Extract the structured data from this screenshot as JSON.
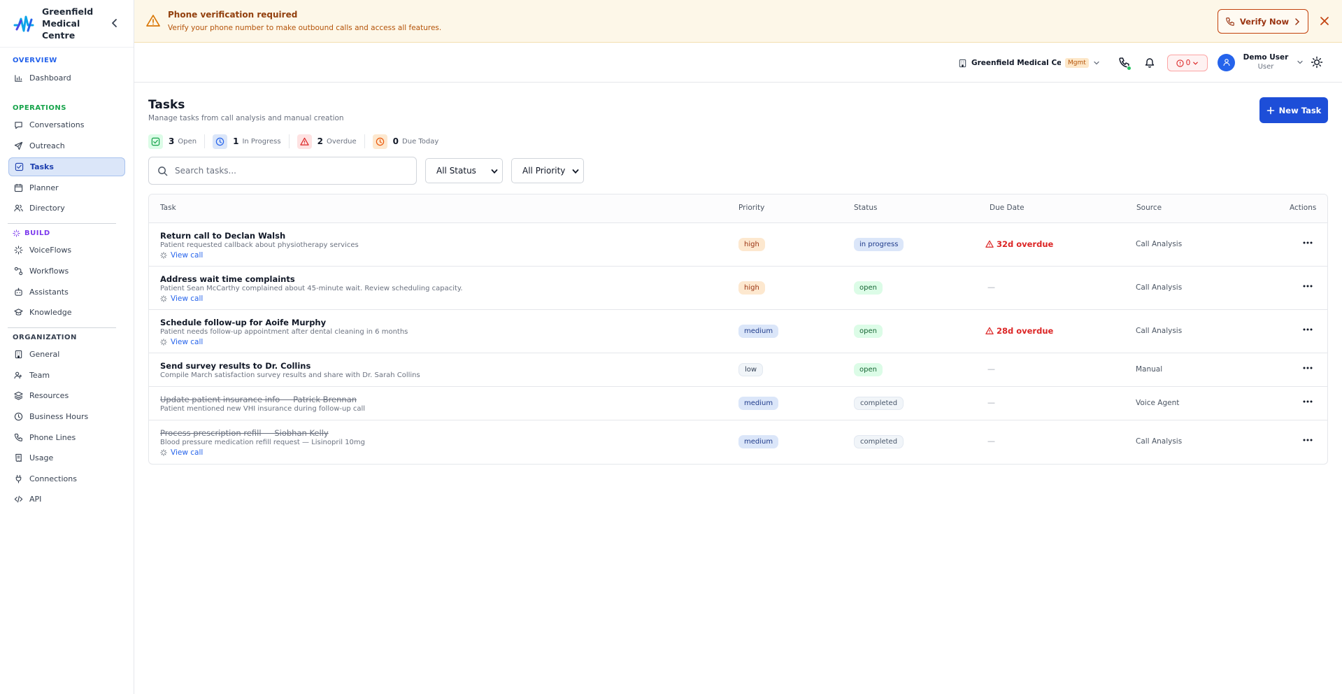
{
  "brand": {
    "name": "Greenfield Medical Centre"
  },
  "sidebar": {
    "sections": [
      {
        "title": "OVERVIEW",
        "items": [
          {
            "label": "Dashboard",
            "icon": "chart-icon"
          }
        ]
      },
      {
        "title": "OPERATIONS",
        "items": [
          {
            "label": "Conversations",
            "icon": "chat-icon"
          },
          {
            "label": "Outreach",
            "icon": "send-icon"
          },
          {
            "label": "Tasks",
            "icon": "tasks-icon",
            "active": true
          },
          {
            "label": "Planner",
            "icon": "calendar-icon"
          },
          {
            "label": "Directory",
            "icon": "users-icon"
          }
        ]
      },
      {
        "title": "BUILD",
        "items": [
          {
            "label": "VoiceFlows",
            "icon": "sparkle-icon"
          },
          {
            "label": "Workflows",
            "icon": "workflow-icon"
          },
          {
            "label": "Assistants",
            "icon": "bot-icon"
          },
          {
            "label": "Knowledge",
            "icon": "graduation-icon"
          }
        ]
      },
      {
        "title": "ORGANIZATION",
        "items": [
          {
            "label": "General",
            "icon": "building-icon"
          },
          {
            "label": "Team",
            "icon": "team-icon"
          },
          {
            "label": "Resources",
            "icon": "layers-icon"
          },
          {
            "label": "Business Hours",
            "icon": "clock-icon"
          },
          {
            "label": "Phone Lines",
            "icon": "phone-icon"
          },
          {
            "label": "Usage",
            "icon": "receipt-icon"
          },
          {
            "label": "Connections",
            "icon": "plug-icon"
          },
          {
            "label": "API",
            "icon": "code-icon"
          }
        ]
      }
    ]
  },
  "banner": {
    "title": "Phone verification required",
    "text": "Verify your phone number to make outbound calls and access all features.",
    "button": "Verify Now"
  },
  "topbar": {
    "org_name": "Greenfield Medical Ce...",
    "org_badge": "Mgmt",
    "alert_count": "0",
    "user_name": "Demo User",
    "user_role": "User"
  },
  "page": {
    "title": "Tasks",
    "subtitle": "Manage tasks from call analysis and manual creation",
    "new_button": "New Task",
    "stats": [
      {
        "count": "3",
        "label": "Open"
      },
      {
        "count": "1",
        "label": "In Progress"
      },
      {
        "count": "2",
        "label": "Overdue"
      },
      {
        "count": "0",
        "label": "Due Today"
      }
    ],
    "search_placeholder": "Search tasks...",
    "filters": {
      "status": "All Status",
      "priority": "All Priority"
    }
  },
  "table": {
    "headers": {
      "task": "Task",
      "priority": "Priority",
      "status": "Status",
      "due": "Due Date",
      "source": "Source",
      "actions": "Actions"
    },
    "view_call_label": "View call",
    "rows": [
      {
        "title": "Return call to Declan Walsh",
        "description": "Patient requested callback about physiotherapy services",
        "view_call": true,
        "priority": "high",
        "status": "in progress",
        "due": "32d overdue",
        "source": "Call Analysis",
        "completed": false
      },
      {
        "title": "Address wait time complaints",
        "description": "Patient Sean McCarthy complained about 45-minute wait. Review scheduling capacity.",
        "view_call": true,
        "priority": "high",
        "status": "open",
        "due": "—",
        "source": "Call Analysis",
        "completed": false
      },
      {
        "title": "Schedule follow-up for Aoife Murphy",
        "description": "Patient needs follow-up appointment after dental cleaning in 6 months",
        "view_call": true,
        "priority": "medium",
        "status": "open",
        "due": "28d overdue",
        "source": "Call Analysis",
        "completed": false
      },
      {
        "title": "Send survey results to Dr. Collins",
        "description": "Compile March satisfaction survey results and share with Dr. Sarah Collins",
        "view_call": false,
        "priority": "low",
        "status": "open",
        "due": "—",
        "source": "Manual",
        "completed": false
      },
      {
        "title": "Update patient insurance info — Patrick Brennan",
        "description": "Patient mentioned new VHI insurance during follow-up call",
        "view_call": false,
        "priority": "medium",
        "status": "completed",
        "due": "—",
        "source": "Voice Agent",
        "completed": true
      },
      {
        "title": "Process prescription refill — Siobhan Kelly",
        "description": "Blood pressure medication refill request — Lisinopril 10mg",
        "view_call": true,
        "priority": "medium",
        "status": "completed",
        "due": "—",
        "source": "Call Analysis",
        "completed": true
      }
    ]
  },
  "colors": {
    "accent": "#1d4ed8",
    "banner_bg": "#fdf7e8",
    "danger": "#dc2626",
    "success": "#22c55e"
  }
}
